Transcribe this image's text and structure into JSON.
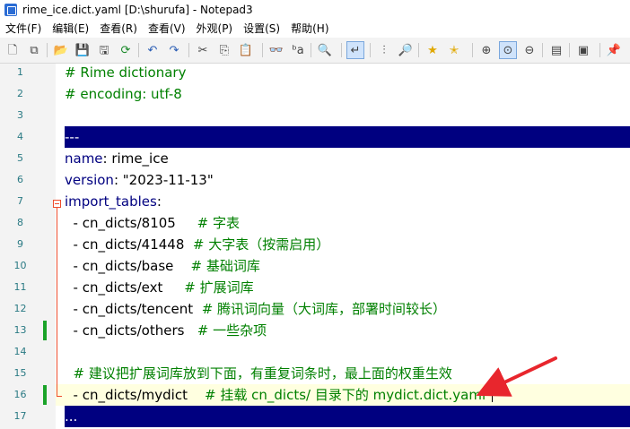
{
  "window": {
    "title": "rime_ice.dict.yaml [D:\\shurufa] - Notepad3"
  },
  "menu": {
    "items": [
      "文件(F)",
      "编辑(E)",
      "查看(R)",
      "查看(V)",
      "外观(P)",
      "设置(S)",
      "帮助(H)"
    ]
  },
  "toolbar": {
    "buttons": [
      {
        "name": "new-file-icon",
        "glyph": "🗋"
      },
      {
        "name": "new-window-icon",
        "glyph": "⧉"
      },
      {
        "name": "open-icon",
        "glyph": "📂"
      },
      {
        "name": "save-icon",
        "glyph": "💾"
      },
      {
        "name": "save-as-icon",
        "glyph": "🖫"
      },
      {
        "name": "reload-icon",
        "glyph": "⟳"
      },
      {
        "name": "undo-icon",
        "glyph": "↶"
      },
      {
        "name": "redo-icon",
        "glyph": "↷"
      },
      {
        "name": "cut-icon",
        "glyph": "✂"
      },
      {
        "name": "copy-icon",
        "glyph": "⎘"
      },
      {
        "name": "paste-icon",
        "glyph": "📋"
      },
      {
        "name": "find-icon",
        "glyph": "👓"
      },
      {
        "name": "replace-icon",
        "glyph": "ᵇa"
      },
      {
        "name": "goto-icon",
        "glyph": "🔍"
      },
      {
        "name": "word-wrap-icon",
        "glyph": "↵"
      },
      {
        "name": "long-line-icon",
        "glyph": "⫶"
      },
      {
        "name": "zoom-search-icon",
        "glyph": "🔎"
      },
      {
        "name": "favorite-icon",
        "glyph": "★"
      },
      {
        "name": "add-favorite-icon",
        "glyph": "✭"
      },
      {
        "name": "zoom-in-icon",
        "glyph": "⊕"
      },
      {
        "name": "zoom-reset-icon",
        "glyph": "⊙"
      },
      {
        "name": "zoom-out-icon",
        "glyph": "⊖"
      },
      {
        "name": "scheme-icon",
        "glyph": "▤"
      },
      {
        "name": "fullscreen-icon",
        "glyph": "▣"
      },
      {
        "name": "pin-icon",
        "glyph": "📌"
      }
    ]
  },
  "editor": {
    "lines": [
      {
        "n": "1",
        "parts": [
          {
            "t": "# Rime dictionary",
            "c": "comment"
          }
        ]
      },
      {
        "n": "2",
        "parts": [
          {
            "t": "# encoding: utf-8",
            "c": "comment"
          }
        ]
      },
      {
        "n": "3",
        "parts": []
      },
      {
        "n": "4",
        "parts": [
          {
            "t": "---",
            "c": "white"
          }
        ],
        "band": true
      },
      {
        "n": "5",
        "parts": [
          {
            "t": "name",
            "c": "key"
          },
          {
            "t": ": rime_ice",
            "c": "dark"
          }
        ]
      },
      {
        "n": "6",
        "parts": [
          {
            "t": "version",
            "c": "key"
          },
          {
            "t": ": \"2023-11-13\"",
            "c": "dark"
          }
        ]
      },
      {
        "n": "7",
        "parts": [
          {
            "t": "import_tables",
            "c": "key"
          },
          {
            "t": ":",
            "c": "dark"
          }
        ]
      },
      {
        "n": "8",
        "parts": [
          {
            "t": "  - cn_dicts/8105     ",
            "c": "dark"
          },
          {
            "t": "# 字表",
            "c": "comment"
          }
        ]
      },
      {
        "n": "9",
        "parts": [
          {
            "t": "  - cn_dicts/41448  ",
            "c": "dark"
          },
          {
            "t": "# 大字表（按需启用）",
            "c": "comment"
          }
        ]
      },
      {
        "n": "10",
        "parts": [
          {
            "t": "  - cn_dicts/base    ",
            "c": "dark"
          },
          {
            "t": "# 基础词库",
            "c": "comment"
          }
        ]
      },
      {
        "n": "11",
        "parts": [
          {
            "t": "  - cn_dicts/ext     ",
            "c": "dark"
          },
          {
            "t": "# 扩展词库",
            "c": "comment"
          }
        ]
      },
      {
        "n": "12",
        "parts": [
          {
            "t": "  - cn_dicts/tencent  ",
            "c": "dark"
          },
          {
            "t": "# 腾讯词向量（大词库，部署时间较长）",
            "c": "comment"
          }
        ]
      },
      {
        "n": "13",
        "parts": [
          {
            "t": "  - cn_dicts/others   ",
            "c": "dark"
          },
          {
            "t": "# 一些杂项",
            "c": "comment"
          }
        ],
        "changed": true
      },
      {
        "n": "14",
        "parts": []
      },
      {
        "n": "15",
        "parts": [
          {
            "t": "  # 建议把扩展词库放到下面，有重复词条时，最上面的权重生效",
            "c": "comment"
          }
        ]
      },
      {
        "n": "16",
        "parts": [
          {
            "t": "  - cn_dicts/mydict    ",
            "c": "dark"
          },
          {
            "t": "# 挂载 cn_dicts/ 目录下的 mydict.dict.yaml",
            "c": "comment"
          }
        ],
        "current": true,
        "changed": true
      },
      {
        "n": "17",
        "parts": [
          {
            "t": "...",
            "c": "white"
          }
        ],
        "band": true
      }
    ]
  },
  "colors": {
    "line_number": "#2a7a84",
    "comment": "#008000",
    "key": "#000080",
    "band": "#000080",
    "change_marker": "#1aa328",
    "fold": "#ee4d2d",
    "arrow": "#e8262d",
    "current_line": "#ffffe0"
  }
}
